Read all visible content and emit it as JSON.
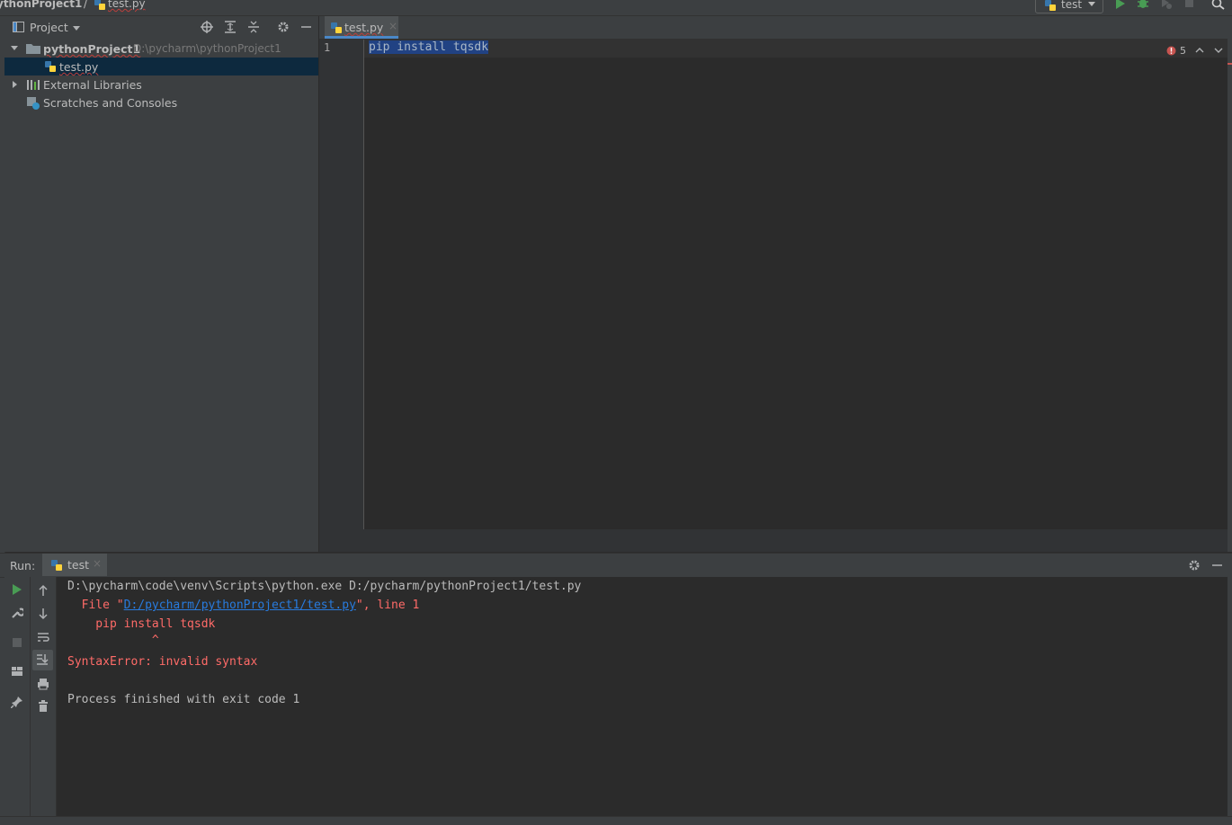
{
  "navbar": {
    "project": "ythonProject1",
    "separator": "/",
    "file": "test.py",
    "run_config": "test"
  },
  "project_panel": {
    "title": "Project",
    "tree": [
      {
        "label": "pythonProject1",
        "path": "D:\\pycharm\\pythonProject1"
      },
      {
        "label": "test.py"
      },
      {
        "label": "External Libraries"
      },
      {
        "label": "Scratches and Consoles"
      }
    ]
  },
  "editor": {
    "tab_label": "test.py",
    "line_number": "1",
    "code": "pip install tqsdk",
    "error_count": "5"
  },
  "run_panel": {
    "label": "Run:",
    "tab_label": "test",
    "console": {
      "command": "D:\\pycharm\\code\\venv\\Scripts\\python.exe D:/pycharm/pythonProject1/test.py",
      "file_prefix": "  File \"",
      "file_link": "D:/pycharm/pythonProject1/test.py",
      "file_suffix": "\", line 1",
      "code_line": "    pip install tqsdk",
      "caret_line": "            ^",
      "error": "SyntaxError: invalid syntax",
      "exit": "Process finished with exit code 1"
    }
  },
  "colors": {
    "background": "#2b2b2b",
    "panel": "#3c3f41",
    "error": "#ff6b68",
    "link": "#287bde",
    "selection": "#214283",
    "run_green": "#499c54"
  }
}
